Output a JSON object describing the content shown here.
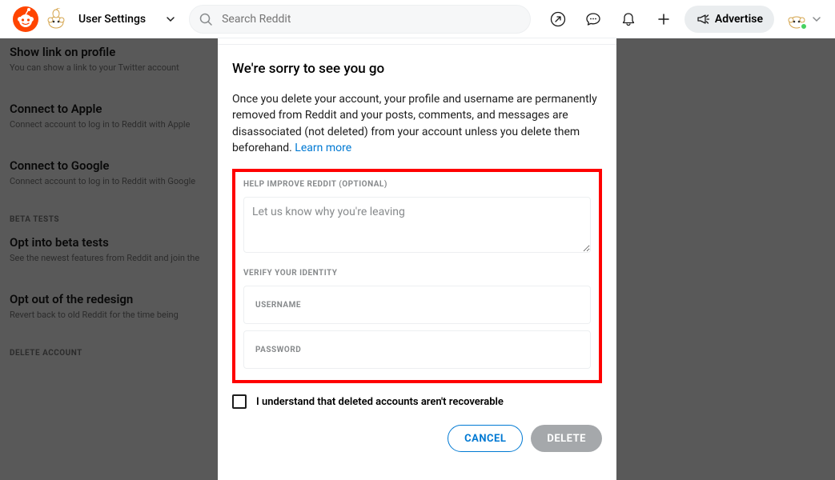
{
  "header": {
    "page_title": "User Settings",
    "search_placeholder": "Search Reddit",
    "advertise_label": "Advertise"
  },
  "bg": {
    "show_link": {
      "title": "Show link on profile",
      "sub": "You can show a link to your Twitter account"
    },
    "apple": {
      "title": "Connect to Apple",
      "sub": "Connect account to log in to Reddit with Apple"
    },
    "google": {
      "title": "Connect to Google",
      "sub": "Connect account to log in to Reddit with Google"
    },
    "beta_cat": "BETA TESTS",
    "opt_in": {
      "title": "Opt into beta tests",
      "sub": "See the newest features from Reddit and join the"
    },
    "opt_out": {
      "title": "Opt out of the redesign",
      "sub": "Revert back to old Reddit for the time being"
    },
    "delete_cat": "DELETE ACCOUNT"
  },
  "modal": {
    "title": "We're sorry to see you go",
    "desc": "Once you delete your account, your profile and username are permanently removed from Reddit and your posts, comments, and messages are disassociated (not deleted) from your account unless you delete them beforehand. ",
    "learn_more": "Learn more",
    "improve_label": "HELP IMPROVE REDDIT (OPTIONAL)",
    "feedback_placeholder": "Let us know why you're leaving",
    "verify_label": "VERIFY YOUR IDENTITY",
    "username_placeholder": "USERNAME",
    "password_placeholder": "PASSWORD",
    "checkbox_label": "I understand that deleted accounts aren't recoverable",
    "cancel_label": "CANCEL",
    "delete_label": "DELETE"
  }
}
